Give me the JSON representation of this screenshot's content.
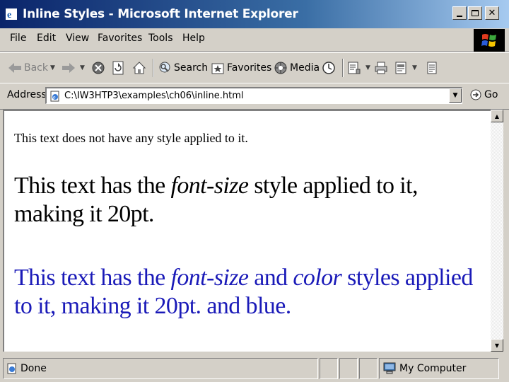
{
  "window": {
    "title": "Inline Styles - Microsoft Internet Explorer"
  },
  "menu": {
    "items": [
      "File",
      "Edit",
      "View",
      "Favorites",
      "Tools",
      "Help"
    ]
  },
  "toolbar": {
    "back": "Back",
    "search": "Search",
    "favorites": "Favorites",
    "media": "Media"
  },
  "address": {
    "label": "Address",
    "value": "C:\\IW3HTP3\\examples\\ch06\\inline.html",
    "go": "Go"
  },
  "content": {
    "p1": "This text does not have any style applied to it.",
    "p2": {
      "before": "This text has the ",
      "em": "font-size",
      "after": " style applied to it, making it 20pt."
    },
    "p3": {
      "before": "This text has the ",
      "em1": "font-size",
      "mid": " and ",
      "em2": "color",
      "after": " styles applied to it, making it 20pt. and blue."
    }
  },
  "status": {
    "text": "Done",
    "zone": "My Computer"
  },
  "colors": {
    "title_start": "#0a246a",
    "title_end": "#a6caf0",
    "chrome": "#d4d0c8",
    "blue_text": "#1a1ab8"
  }
}
